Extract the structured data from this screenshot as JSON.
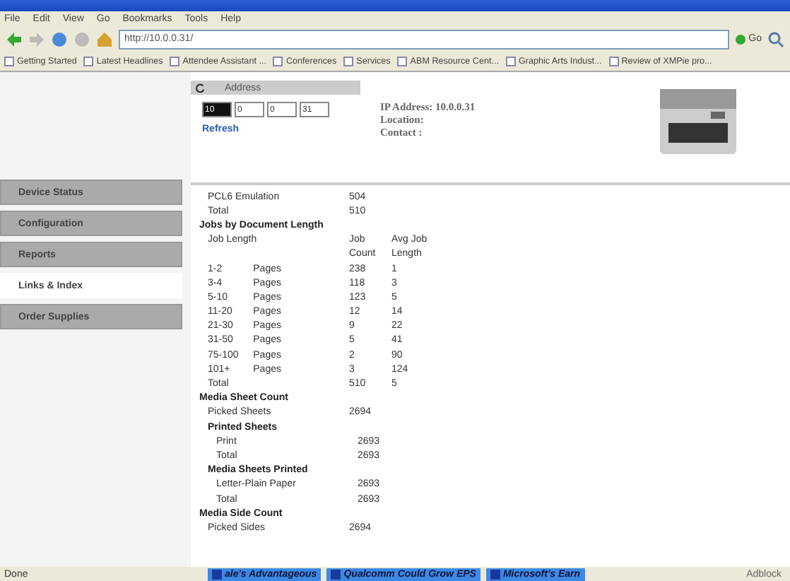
{
  "menu": [
    "File",
    "Edit",
    "View",
    "Go",
    "Bookmarks",
    "Tools",
    "Help"
  ],
  "url": "http://10.0.0.31/",
  "go_label": "Go",
  "bookmarks": [
    "Getting Started",
    "Latest Headlines",
    "Attendee Assistant ...",
    "Conferences",
    "Services",
    "ABM Resource Cent...",
    "Graphic Arts Indust...",
    "Review of XMPie pro..."
  ],
  "address": {
    "title": "Address",
    "octets": [
      "10",
      "0",
      "0",
      "31"
    ],
    "refresh": "Refresh"
  },
  "printer_info": [
    "IP Address: 10.0.0.31",
    "Location:",
    "Contact :"
  ],
  "sidebar": [
    {
      "label": "Device Status",
      "selected": false
    },
    {
      "label": "Configuration",
      "selected": false
    },
    {
      "label": "Reports",
      "selected": false
    },
    {
      "label": "Links & Index",
      "selected": true
    },
    {
      "label": "Order Supplies",
      "selected": false
    }
  ],
  "rows": [
    {
      "kind": "item",
      "label": "PCL6 Emulation",
      "col_2": "504"
    },
    {
      "kind": "item",
      "label": "Total",
      "col_2": "510"
    },
    {
      "kind": "heading",
      "label": "Jobs by Document Length"
    },
    {
      "kind": "item",
      "label": "Job Length",
      "col_2": "Job",
      "col_3": "Avg Job"
    },
    {
      "kind": "item",
      "col_2": "Count",
      "col_3": "Length"
    },
    {
      "kind": "range",
      "label": "1-2",
      "unit": "Pages",
      "col_2": "238",
      "col_3": "1"
    },
    {
      "kind": "range",
      "label": "3-4",
      "unit": "Pages",
      "col_2": "118",
      "col_3": "3"
    },
    {
      "kind": "range",
      "label": "5-10",
      "unit": "Pages",
      "col_2": "123",
      "col_3": "5"
    },
    {
      "kind": "range",
      "label": "11-20",
      "unit": "Pages",
      "col_2": "12",
      "col_3": "14"
    },
    {
      "kind": "range",
      "label": "21-30",
      "unit": "Pages",
      "col_2": "9",
      "col_3": "22"
    },
    {
      "kind": "range",
      "label": "31-50",
      "unit": "Pages",
      "col_2": "5",
      "col_3": "41"
    },
    {
      "kind": "range",
      "label": "75-100",
      "unit": "Pages",
      "col_2": "2",
      "col_3": "90"
    },
    {
      "kind": "range",
      "label": "101+",
      "unit": "Pages",
      "col_2": "3",
      "col_3": "124"
    },
    {
      "kind": "item",
      "label": "Total",
      "col_2": "510",
      "col_3": "5"
    },
    {
      "kind": "heading",
      "label": "Media Sheet Count"
    },
    {
      "kind": "item",
      "label": "Picked Sheets",
      "col_2": "2694"
    },
    {
      "kind": "subheading",
      "label": "Printed Sheets"
    },
    {
      "kind": "subitem",
      "label": "Print",
      "col_2": "2693"
    },
    {
      "kind": "subitem",
      "label": "Total",
      "col_2": "2693"
    },
    {
      "kind": "subheading",
      "label": "Media Sheets Printed"
    },
    {
      "kind": "subitem",
      "label": "Letter-Plain Paper",
      "col_2": "2693"
    },
    {
      "kind": "subitem",
      "label": "Total",
      "col_2": "2693"
    },
    {
      "kind": "heading",
      "label": "Media Side Count"
    },
    {
      "kind": "item",
      "label": "Picked Sides",
      "col_2": "2694"
    }
  ],
  "status": "Done",
  "taskbar": [
    "ale's Advantageous",
    "Qualcomm Could Grow EPS",
    "Microsoft's Earn"
  ],
  "tray_text": "Adblock"
}
